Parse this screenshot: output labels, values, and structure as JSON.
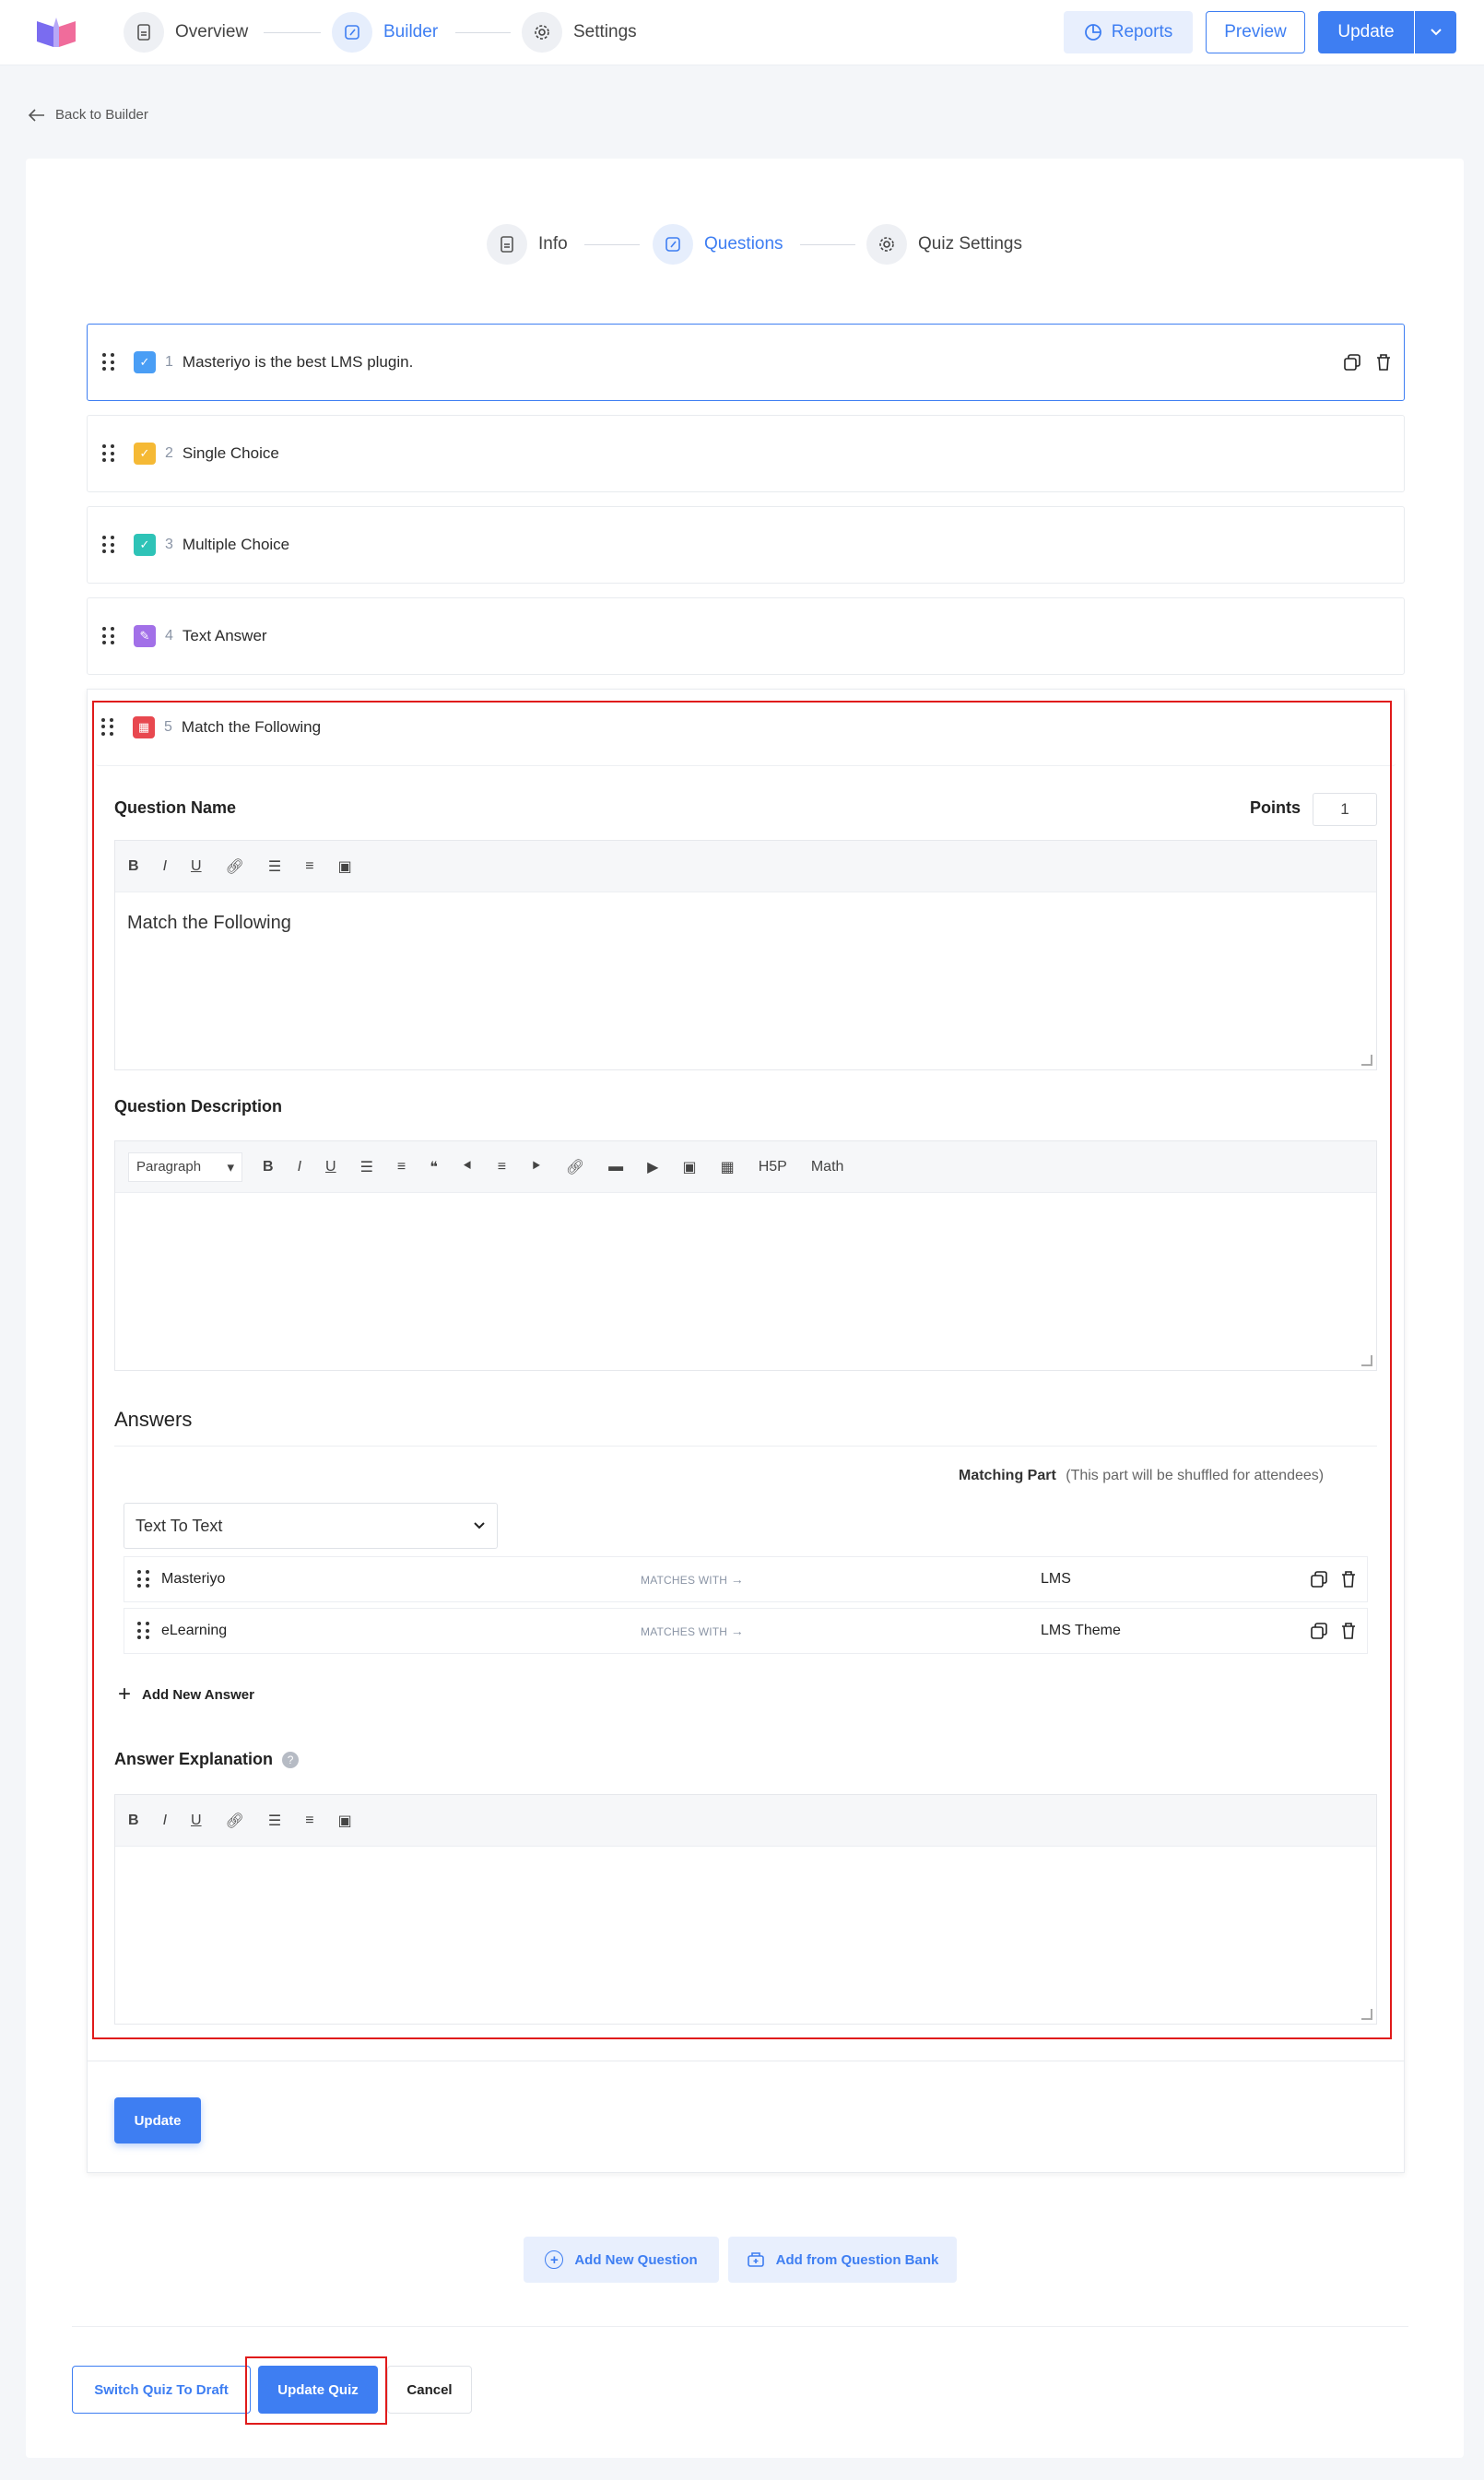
{
  "topbar": {
    "steps": [
      {
        "label": "Overview"
      },
      {
        "label": "Builder"
      },
      {
        "label": "Settings"
      }
    ],
    "reports_label": "Reports",
    "preview_label": "Preview",
    "update_label": "Update"
  },
  "back_label": "Back to Builder",
  "substeps": [
    {
      "label": "Info"
    },
    {
      "label": "Questions"
    },
    {
      "label": "Quiz Settings"
    }
  ],
  "questions": [
    {
      "num": "1",
      "name": "Masteriyo is the best LMS plugin.",
      "color": "#4a9ef5"
    },
    {
      "num": "2",
      "name": "Single Choice",
      "color": "#f5b935"
    },
    {
      "num": "3",
      "name": "Multiple Choice",
      "color": "#2ec3b7"
    },
    {
      "num": "4",
      "name": "Text Answer",
      "color": "#a270e8"
    },
    {
      "num": "5",
      "name": "Match the Following",
      "color": "#e8484f"
    }
  ],
  "editor": {
    "question_name_label": "Question Name",
    "points_label": "Points",
    "points_value": "1",
    "question_name_value": "Match the Following",
    "description_label": "Question Description",
    "paragraph_label": "Paragraph",
    "h5p_label": "H5P",
    "math_label": "Math",
    "answers_label": "Answers",
    "matching_part_label": "Matching Part",
    "matching_part_note": "(This part will be shuffled for attendees)",
    "answer_type": "Text To Text",
    "answers": [
      {
        "left": "Masteriyo",
        "matches": "MATCHES WITH",
        "right": "LMS"
      },
      {
        "left": "eLearning",
        "matches": "MATCHES WITH",
        "right": "LMS Theme"
      }
    ],
    "add_answer_label": "Add New Answer",
    "explanation_label": "Answer Explanation",
    "update_label": "Update"
  },
  "footer": {
    "add_question_label": "Add New Question",
    "add_bank_label": "Add from Question Bank",
    "draft_label": "Switch Quiz To Draft",
    "update_quiz_label": "Update Quiz",
    "cancel_label": "Cancel"
  },
  "colors": {
    "accent": "#3e7ef2",
    "highlight": "#e01b1b"
  }
}
